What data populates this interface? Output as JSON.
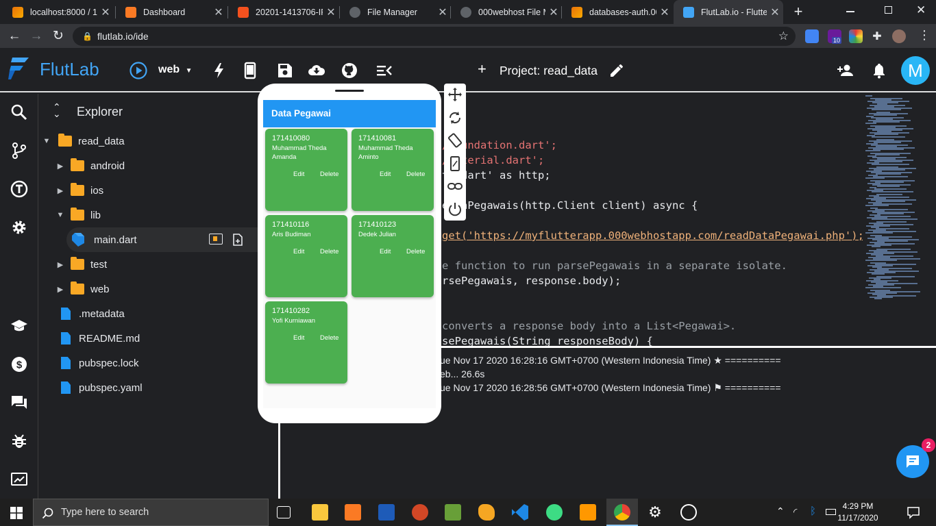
{
  "browser": {
    "tabs": [
      {
        "title": "localhost:8000 / 1..",
        "color": "#e8710a"
      },
      {
        "title": "Dashboard",
        "color": "#fb7a24"
      },
      {
        "title": "20201-1413706-IF",
        "color": "#f4511e"
      },
      {
        "title": "File Manager",
        "color": "#9aa0a6"
      },
      {
        "title": "000webhost File M",
        "color": "#9aa0a6"
      },
      {
        "title": "databases-auth.00",
        "color": "#e8710a"
      },
      {
        "title": "FlutLab.io - Flutter",
        "color": "#42a5f5"
      }
    ],
    "new_tab": "+",
    "url": "flutlab.io/ide",
    "ext_badge": "10"
  },
  "app": {
    "logo_text": "FlutLab",
    "platform": "web",
    "project_label": "Project: read_data",
    "avatar_letter": "M"
  },
  "explorer": {
    "title": "Explorer",
    "root": "read_data",
    "items": [
      {
        "label": "android",
        "type": "folder",
        "level": 1,
        "open": false
      },
      {
        "label": "ios",
        "type": "folder",
        "level": 1,
        "open": false
      },
      {
        "label": "lib",
        "type": "folder",
        "level": 1,
        "open": true
      },
      {
        "label": "main.dart",
        "type": "dart",
        "level": 2,
        "open": false
      },
      {
        "label": "test",
        "type": "folder",
        "level": 1,
        "open": false
      },
      {
        "label": "web",
        "type": "folder",
        "level": 1,
        "open": false
      },
      {
        "label": ".metadata",
        "type": "file",
        "level": 0,
        "open": false
      },
      {
        "label": "README.md",
        "type": "file",
        "level": 0,
        "open": false
      },
      {
        "label": "pubspec.lock",
        "type": "file",
        "level": 0,
        "open": false
      },
      {
        "label": "pubspec.yaml",
        "type": "file",
        "level": 0,
        "open": false
      }
    ]
  },
  "editor": {
    "lines": [
      "/foundation.dart';",
      "/material.dart';",
      "tp.dart' as http;",
      "",
      "etchPegawais(http.Client client) async {",
      "",
      "get('https://myflutterapp.000webhostapp.com/readDataPegawai.php');",
      "",
      "e function to run parsePegawais in a separate isolate.",
      "rsePegawais, response.body);",
      "",
      "",
      "converts a response body into a List<Pegawai>.",
      "sePegawais(String responseBody) {"
    ]
  },
  "console": {
    "lines": [
      "ue Nov 17 2020 16:28:16 GMT+0700 (Western Indonesia Time) ★ ==========",
      "eb... 26.6s",
      "ue Nov 17 2020 16:28:56 GMT+0700 (Western Indonesia Time) ⚑ =========="
    ]
  },
  "phone": {
    "appbar_title": "Data Pegawai",
    "cards": [
      {
        "nim": "171410080",
        "nama": "Muhammad Theda Amanda",
        "edit": "Edit",
        "delete": "Delete"
      },
      {
        "nim": "171410081",
        "nama": "Muhammad Theda Aminto",
        "edit": "Edit",
        "delete": "Delete"
      },
      {
        "nim": "171410116",
        "nama": "Aris Budiman",
        "edit": "Edit",
        "delete": "Delete"
      },
      {
        "nim": "171410123",
        "nama": "Dedek Julian",
        "edit": "Edit",
        "delete": "Delete"
      },
      {
        "nim": "171410282",
        "nama": "Yofi Kurniawan",
        "edit": "Edit",
        "delete": "Delete"
      }
    ]
  },
  "chat": {
    "badge": "2"
  },
  "taskbar": {
    "search_placeholder": "Type here to search",
    "time": "4:29 PM",
    "date": "11/17/2020"
  }
}
